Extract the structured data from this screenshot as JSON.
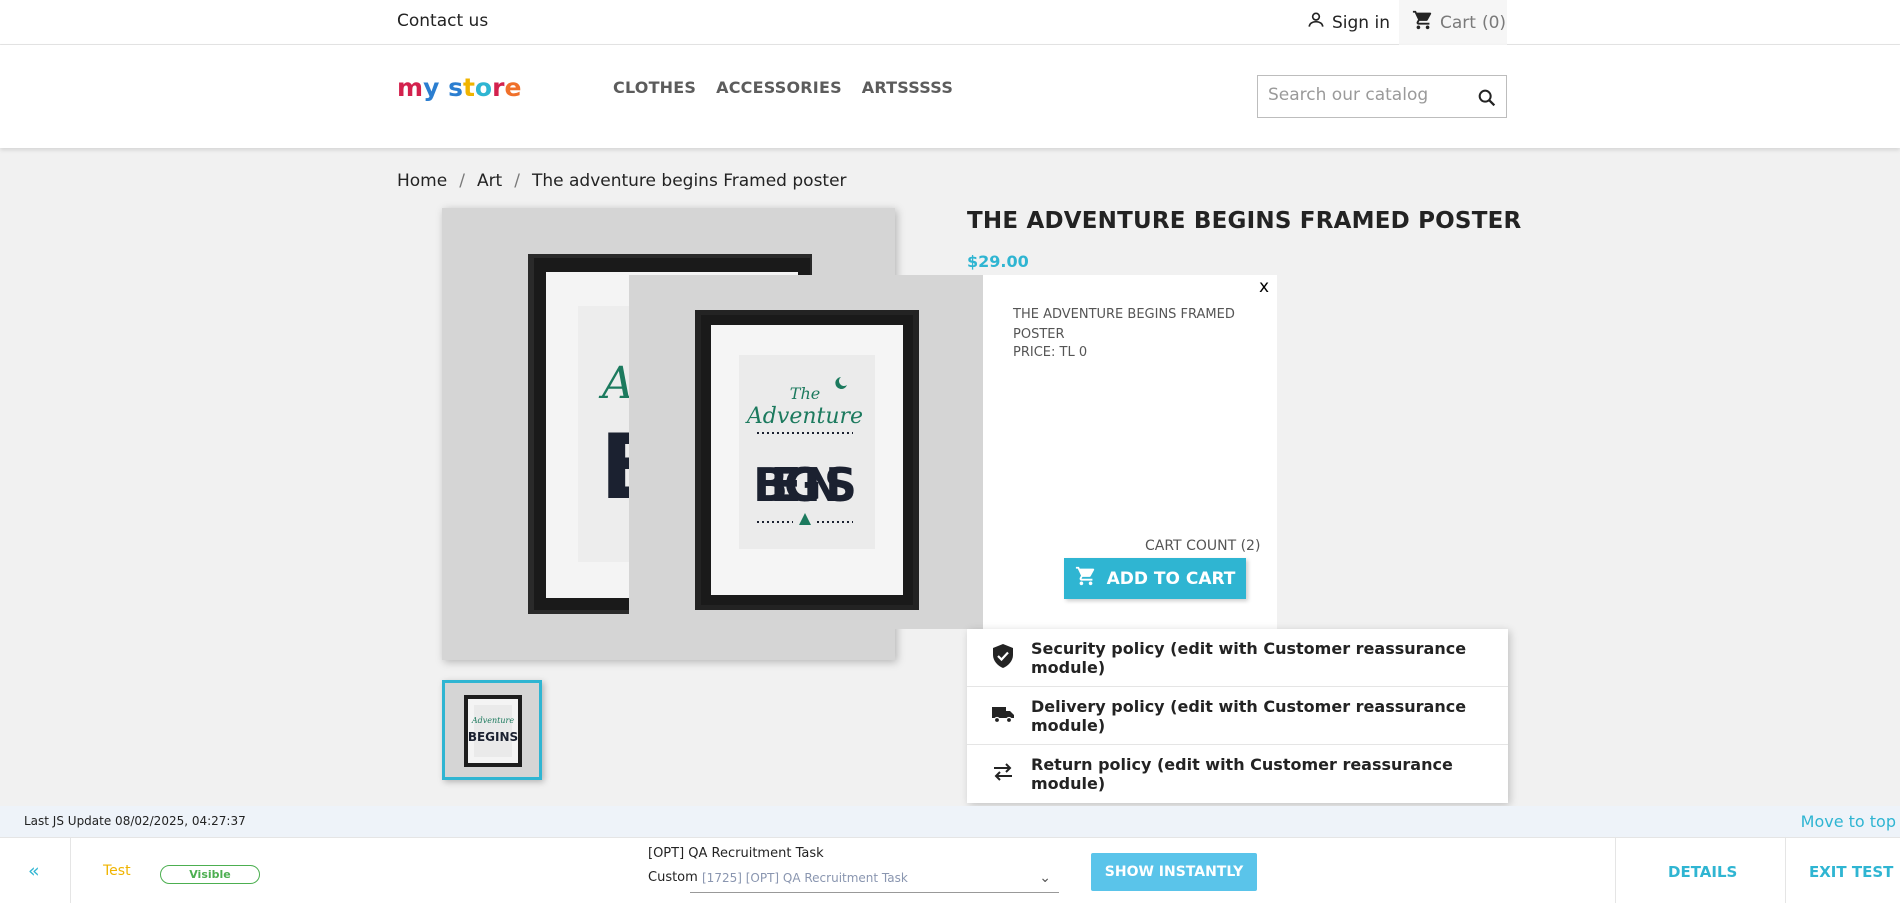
{
  "topbar": {
    "contact_label": "Contact us",
    "signin_label": "Sign in",
    "cart_label": "Cart",
    "cart_count": "(0)"
  },
  "header": {
    "logo_letters": [
      "m",
      "y",
      " ",
      "s",
      "t",
      "o",
      "r",
      "e"
    ],
    "logo_colors": [
      "#d3214d",
      "#2b7ed0",
      "#ffffff",
      "#2b7ed0",
      "#f0b400",
      "#2fb5d2",
      "#d3214d",
      "#f0702a"
    ],
    "nav": [
      "CLOTHES",
      "ACCESSORIES",
      "ARTSSSSS"
    ],
    "search_placeholder": "Search our catalog"
  },
  "breadcrumb": [
    "Home",
    "Art",
    "The adventure begins Framed poster"
  ],
  "product": {
    "title": "THE ADVENTURE BEGINS FRAMED POSTER",
    "price": "$29.00"
  },
  "poster": {
    "the": "The",
    "adventure": "Adventure",
    "begins": "BEGINS"
  },
  "popup": {
    "close_label": "x",
    "name": "THE ADVENTURE BEGINS FRAMED POSTER",
    "price": "PRICE: TL 0",
    "cart_count": "CART COUNT (2)",
    "add_label": "ADD TO CART"
  },
  "reassurance": [
    {
      "label": "Security policy (edit with Customer reassurance module)",
      "icon": "shield-icon"
    },
    {
      "label": "Delivery policy (edit with Customer reassurance module)",
      "icon": "truck-icon"
    },
    {
      "label": "Return policy (edit with Customer reassurance module)",
      "icon": "swap-arrows-icon"
    }
  ],
  "toolbar": {
    "last_update": "Last JS Update 08/02/2025, 04:27:37",
    "move_to_top": "Move to top",
    "collapse": "«",
    "test_label": "Test",
    "visible_badge": "Visible",
    "task_name": "[OPT] QA Recruitment Task",
    "custom_label": "Custom",
    "select_value": "[1725] [OPT] QA Recruitment Task",
    "show_label": "SHOW INSTANTLY",
    "details_label": "DETAILS",
    "exit_label": "EXIT TEST"
  },
  "colors": {
    "accent": "#2fb5d2",
    "badge_green": "#4caf50",
    "test_yellow": "#f0b400"
  }
}
